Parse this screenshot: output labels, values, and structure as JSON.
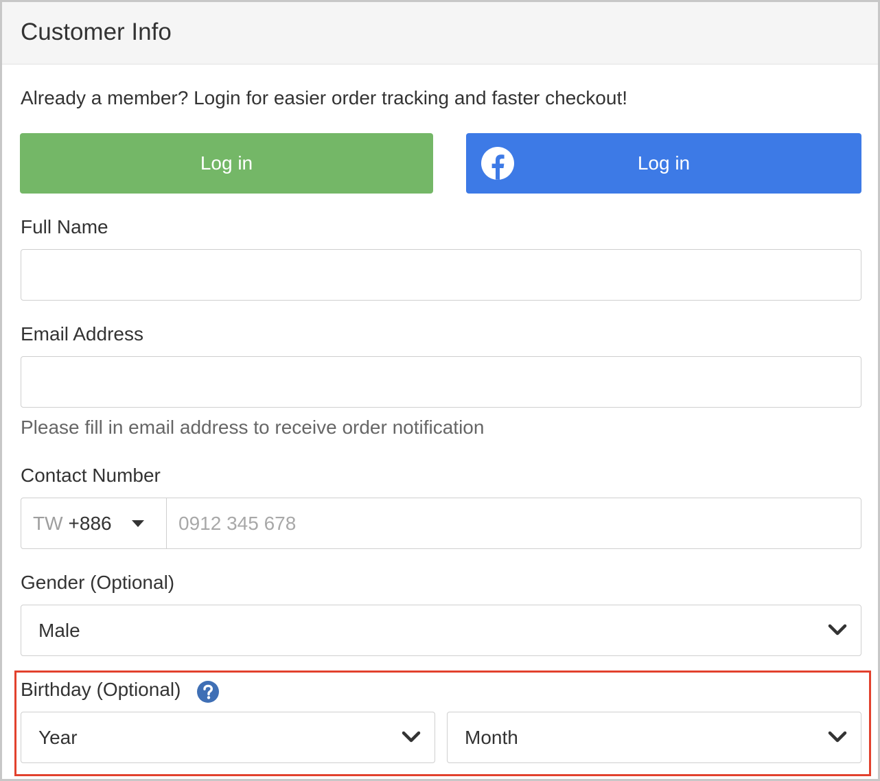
{
  "header": {
    "title": "Customer Info"
  },
  "login": {
    "prompt": "Already a member? Login for easier order tracking and faster checkout!",
    "login_label": "Log in",
    "facebook_login_label": "Log in"
  },
  "form": {
    "full_name": {
      "label": "Full Name",
      "value": "",
      "placeholder": ""
    },
    "email": {
      "label": "Email Address",
      "value": "",
      "placeholder": "",
      "hint": "Please fill in email address to receive order notification"
    },
    "contact": {
      "label": "Contact Number",
      "country_code": "TW",
      "dial_code": "+886",
      "placeholder": "0912 345 678",
      "value": ""
    },
    "gender": {
      "label": "Gender (Optional)",
      "selected": "Male"
    },
    "birthday": {
      "label": "Birthday (Optional)",
      "year_selected": "Year",
      "month_selected": "Month",
      "help_icon": "question-circle-icon"
    }
  },
  "colors": {
    "login_button": "#74b767",
    "facebook_button": "#3d7ae6",
    "highlight_border": "#e2412d",
    "help_icon": "#3f6fb5"
  }
}
